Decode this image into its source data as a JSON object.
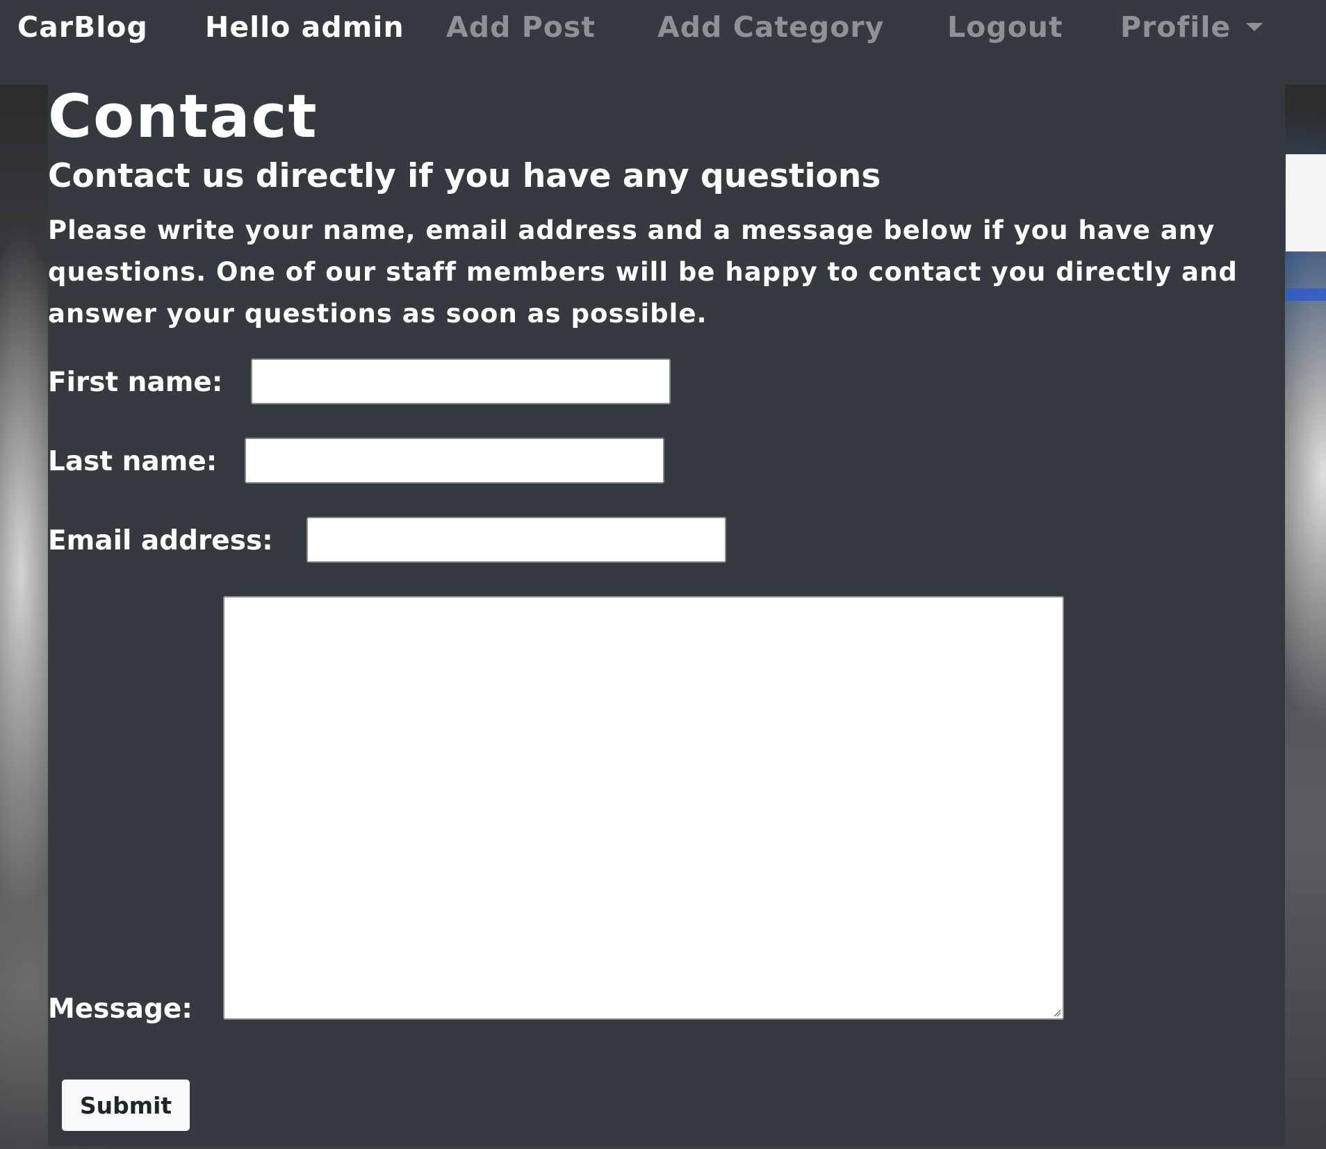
{
  "navbar": {
    "brand": "CarBlog",
    "greeting": "Hello admin",
    "links": {
      "add_post": "Add Post",
      "add_category": "Add Category",
      "logout": "Logout",
      "profile": "Profile"
    },
    "profile_icon": "caret-down-icon"
  },
  "page": {
    "title": "Contact",
    "subtitle": "Contact us directly if you have any questions",
    "intro": "Please write your name, email address and a message below if you have any questions. One of our staff members will be happy to contact you directly and answer your questions as soon as possible."
  },
  "form": {
    "first_name_label": "First name:",
    "first_name_value": "",
    "last_name_label": "Last name:",
    "last_name_value": "",
    "email_label": "Email address:",
    "email_value": "",
    "message_label": "Message:",
    "message_value": "",
    "submit_label": "Submit"
  },
  "colors": {
    "navbar_bg": "#343a40",
    "panel_bg": "#343a40",
    "nav_muted": "#8e9195",
    "text": "#ffffff",
    "button_bg": "#f8f9fa"
  }
}
